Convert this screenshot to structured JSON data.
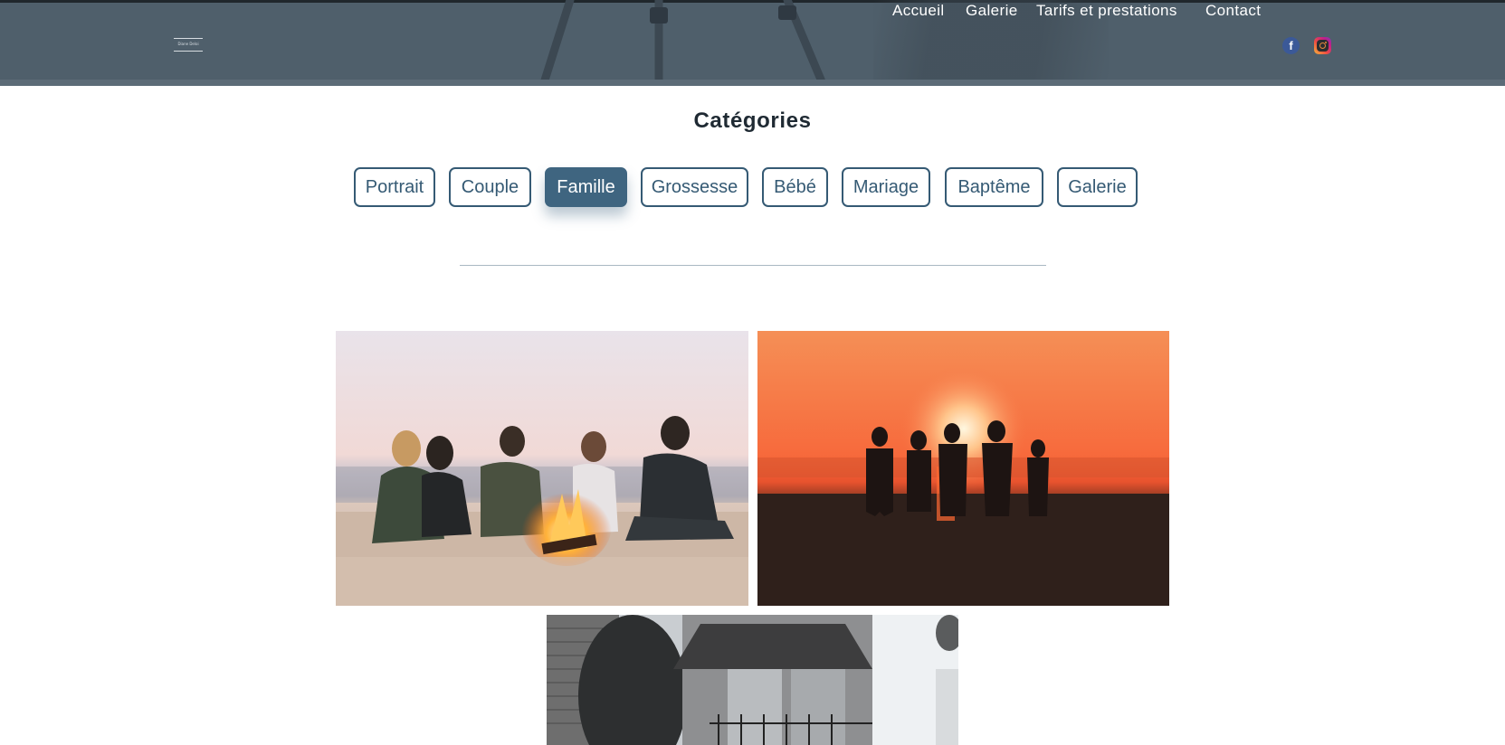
{
  "header": {
    "logo_text": "Diane Deloi",
    "nav": [
      "Accueil",
      "Galerie",
      "Tarifs et prestations",
      "Contact"
    ],
    "social": [
      "facebook-icon",
      "instagram-icon"
    ]
  },
  "categories": {
    "title": "Catégories",
    "items": [
      "Portrait",
      "Couple",
      "Famille",
      "Grossesse",
      "Bébé",
      "Mariage",
      "Baptême",
      "Galerie"
    ],
    "active": "Famille"
  },
  "gallery": {
    "photos": [
      {
        "name": "friends-campfire-beach-photo"
      },
      {
        "name": "family-sunset-beach-photo"
      },
      {
        "name": "building-black-white-photo"
      }
    ]
  },
  "colors": {
    "header_bg": "#4f5f6b",
    "accent": "#355a74",
    "active_bg": "#3f6580"
  }
}
